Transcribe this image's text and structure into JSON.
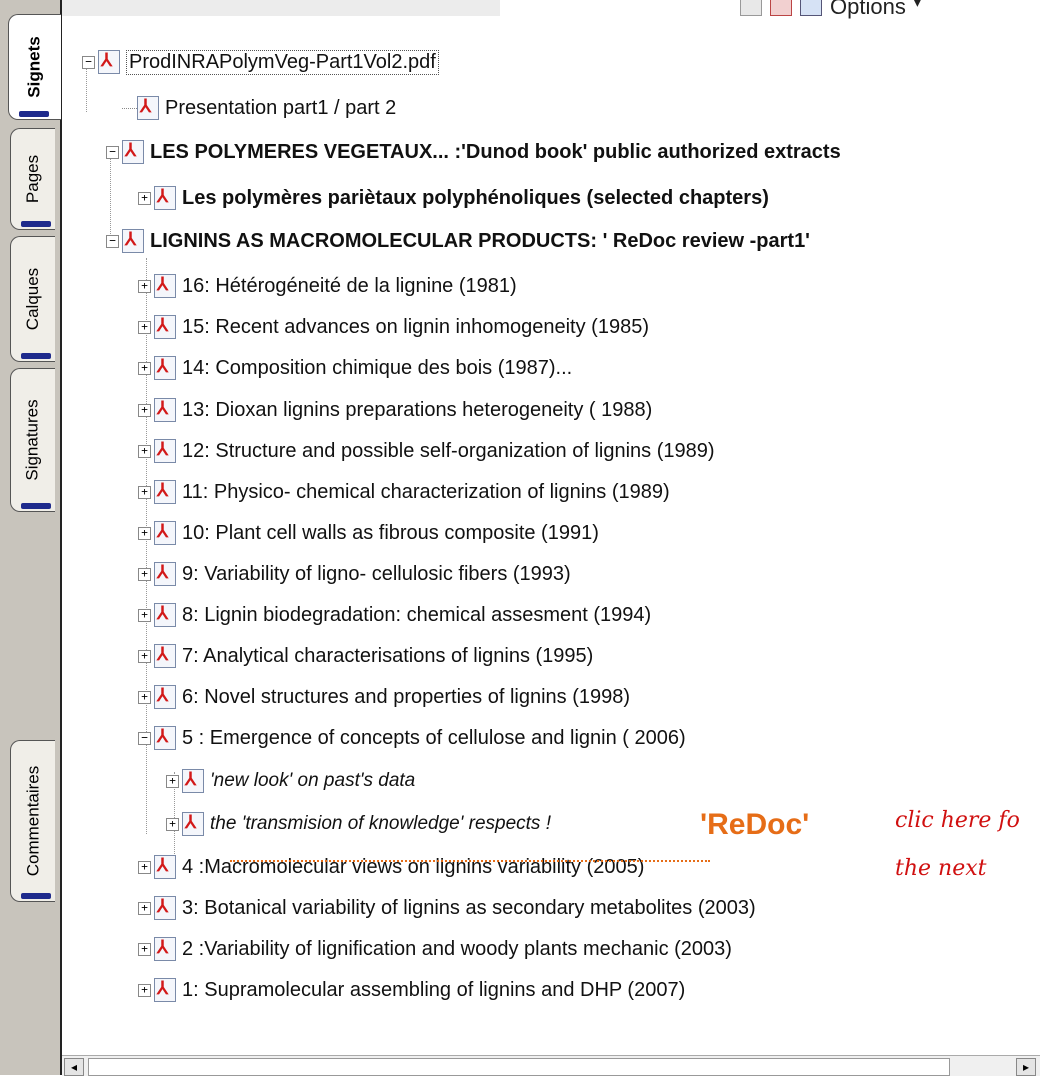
{
  "toolbar": {
    "options_label": "Options",
    "options_arrow": "▾"
  },
  "tabs": [
    {
      "label": "Signets",
      "active": true
    },
    {
      "label": "Pages",
      "active": false
    },
    {
      "label": "Calques",
      "active": false
    },
    {
      "label": "Signatures",
      "active": false
    },
    {
      "label": "Commentaires",
      "active": false
    }
  ],
  "tree": {
    "root": "ProdINRAPolymVeg-Part1Vol2.pdf",
    "presentation": "Presentation part1 / part 2",
    "polymeres": "LES POLYMERES VEGETAUX... :'Dunod book' public authorized extracts",
    "parietaux": "Les polymères pariètaux polyphénoliques (selected chapters)",
    "lignins": "LIGNINS AS MACROMOLECULAR PRODUCTS: ' ReDoc review -part1'",
    "items": [
      "16: Hétérogéneité de la lignine (1981)",
      "15: Recent advances on lignin inhomogeneity (1985)",
      "14: Composition chimique des bois (1987)...",
      "13: Dioxan lignins preparations heterogeneity ( 1988)",
      "12: Structure and possible self-organization of lignins (1989)",
      "11: Physico- chemical characterization of lignins (1989)",
      "10: Plant cell walls as fibrous composite (1991)",
      "9: Variability of ligno- cellulosic fibers (1993)",
      "8:  Lignin biodegradation: chemical assesment (1994)",
      "7: Analytical characterisations of lignins (1995)",
      "6: Novel structures and properties of lignins (1998)",
      "5 : Emergence of concepts of cellulose and lignin ( 2006)"
    ],
    "sub_items": [
      "'new look' on past's data",
      "the 'transmision of knowledge' respects !"
    ],
    "items_after": [
      "4 :Macromolecular views on lignins variability (2005)",
      "3: Botanical variability of lignins as secondary metabolites (2003)",
      "2 :Variability of lignification and woody plants mechanic (2003)",
      "1: Supramolecular assembling of lignins and DHP (2007)"
    ]
  },
  "annotation": {
    "redoc": "'ReDoc'",
    "hint_line1": "clic here fo",
    "hint_line2": "the next"
  },
  "symbols": {
    "plus": "+",
    "minus": "−",
    "left_arrow": "◂",
    "right_arrow": "▸"
  },
  "colors": {
    "pdf_red": "#d21919",
    "annotation_orange": "#e66d17",
    "hint_red": "#d01010"
  }
}
